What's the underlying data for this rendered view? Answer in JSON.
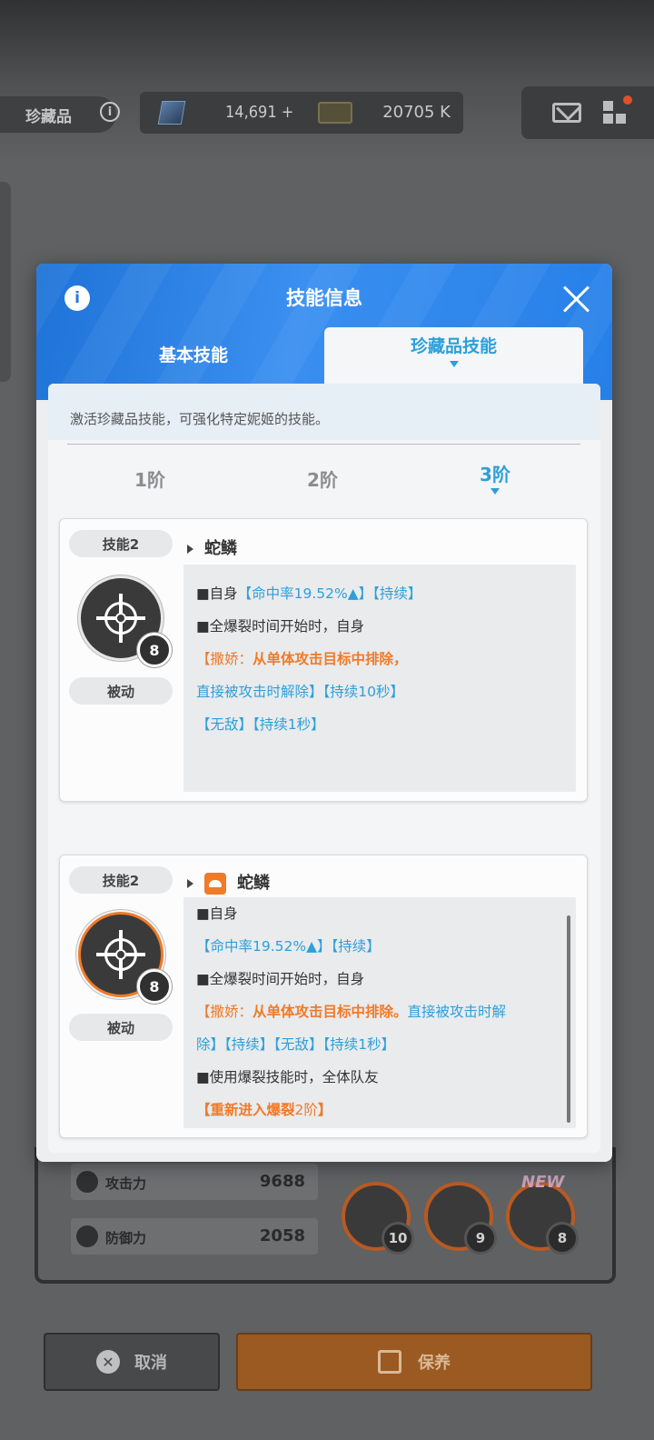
{
  "topbar": {
    "collection_label": "珍藏品",
    "gems": "14,691 +",
    "credits": "20705 K"
  },
  "modal": {
    "title": "技能信息",
    "tabs": [
      {
        "label": "基本技能",
        "active": false
      },
      {
        "label": "珍藏品技能",
        "active": true
      }
    ],
    "description": "激活珍藏品技能，可强化特定妮姬的技能。",
    "tiers": [
      {
        "label": "1阶",
        "active": false
      },
      {
        "label": "2阶",
        "active": false
      },
      {
        "label": "3阶",
        "active": true
      }
    ],
    "cards": [
      {
        "slot": "技能2",
        "type": "被动",
        "level": "8",
        "name": "蛇鳞",
        "lines": [
          "■自身",
          "【命中率19.52%▲】【持续】",
          "■全爆裂时间开始时，自身",
          "【撒娇：",
          "从单体攻击目标中排除，",
          "直接被攻击时解除】【持续10秒】",
          "【无敌】【持续1秒】"
        ]
      },
      {
        "slot": "技能2",
        "type": "被动",
        "level": "8",
        "name": "蛇鳞",
        "lines": [
          "■自身",
          "【命中率19.52%▲】【持续】",
          "■全爆裂时间开始时，自身",
          "【撒娇：",
          "从单体攻击目标中排除。",
          "直接被攻击时解",
          "除】【持续】【无敌】【持续1秒】",
          "■使用爆裂技能时，全体队友",
          "【重新进入爆裂",
          "2阶",
          "】"
        ]
      }
    ]
  },
  "stats": [
    {
      "label": "攻击力",
      "value": "9688"
    },
    {
      "label": "防御力",
      "value": "2058"
    }
  ],
  "skill_icons": [
    {
      "level": "10"
    },
    {
      "level": "9"
    },
    {
      "level": "8",
      "badge": "NEW"
    }
  ],
  "buttons": {
    "cancel": "取消",
    "maintain": "保养"
  },
  "colors": {
    "accent_blue": "#2e9fd8",
    "accent_orange": "#f07a28",
    "header_blue": "#2680e8"
  }
}
